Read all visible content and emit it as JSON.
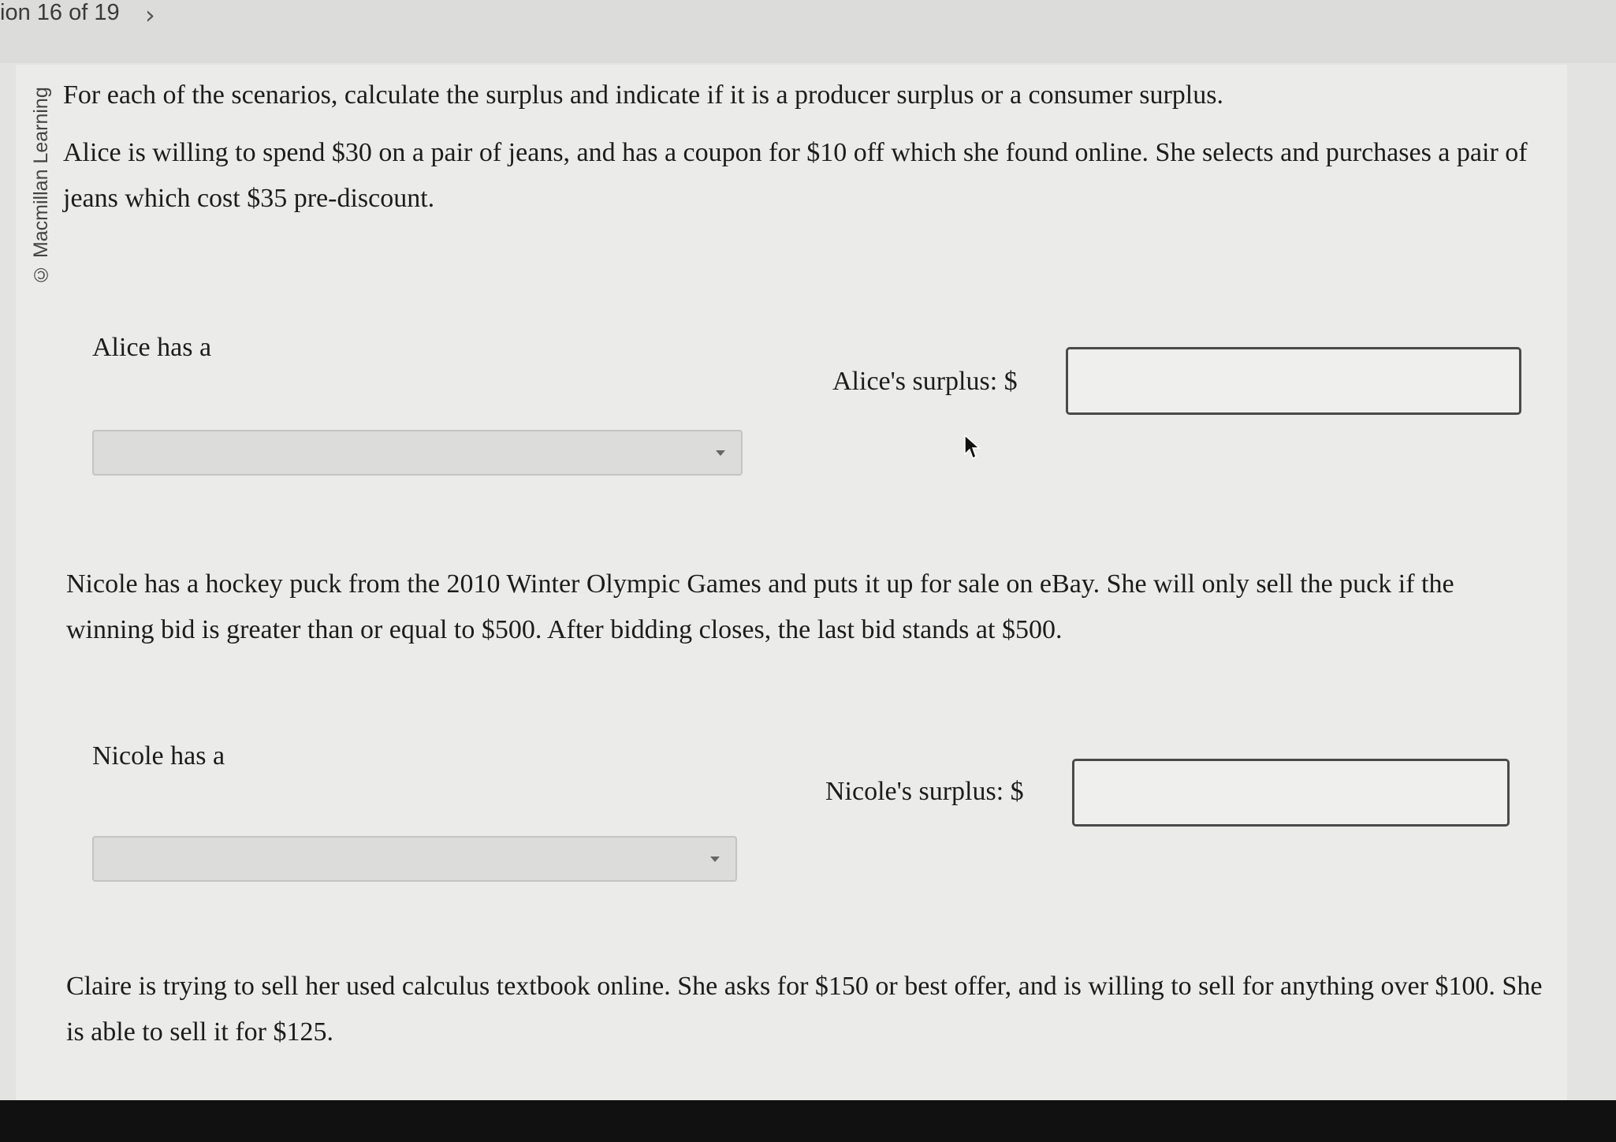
{
  "header": {
    "question_counter": "ion 16 of 19",
    "next_icon": "chevron-right-icon"
  },
  "copyright": "© Macmillan Learning",
  "instructions": "For each of the scenarios, calculate the surplus and indicate if it is a producer surplus or a consumer surplus.",
  "scenarios": [
    {
      "text": "Alice is willing to spend $30 on a pair of jeans, and has a coupon for $10 off which she found online. She selects and purchases a pair of jeans which cost $35 pre-discount.",
      "has_label": "Alice has a",
      "select_value": "",
      "surplus_label": "Alice's surplus: $",
      "surplus_value": ""
    },
    {
      "text": "Nicole has a hockey puck from the 2010 Winter Olympic Games and puts it up for sale on eBay. She will only sell the puck if the winning bid is greater than or equal to $500. After bidding closes, the last bid stands at $500.",
      "has_label": "Nicole has a",
      "select_value": "",
      "surplus_label": "Nicole's surplus: $",
      "surplus_value": ""
    },
    {
      "text": "Claire is trying to sell her used calculus textbook online. She asks for $150 or best offer, and is willing to sell for anything over $100. She is able to sell it for $125."
    }
  ],
  "pointer_icon": "mouse-pointer-icon"
}
